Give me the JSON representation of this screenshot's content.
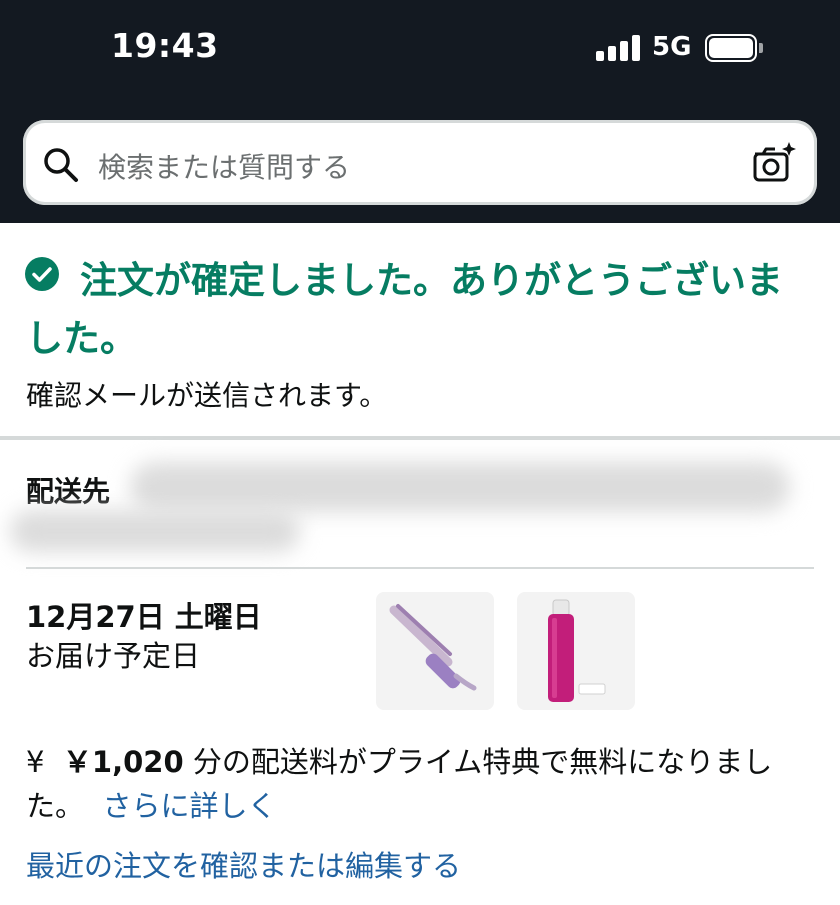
{
  "status_bar": {
    "time": "19:43",
    "network": "5G"
  },
  "search": {
    "placeholder": "検索または質問する"
  },
  "confirmation": {
    "title": "注文が確定しました。ありがとうございました。",
    "subtitle": "確認メールが送信されます。",
    "accent_color": "#067d62"
  },
  "shipping_address": {
    "label": "配送先"
  },
  "delivery": {
    "date": "12月27日 土曜日",
    "note": "お届け予定日",
    "items": [
      {
        "icon": "curling-iron-product-image"
      },
      {
        "icon": "hair-spray-product-image"
      }
    ]
  },
  "shipping_fee": {
    "currency_symbol": "¥",
    "amount": "￥1,020",
    "text": "分の配送料がプライム特典で無料になりました。",
    "learn_more": "さらに詳しく"
  },
  "recent_orders_link": "最近の注文を確認または編集する",
  "colors": {
    "header_bg": "#131921",
    "link": "#2162a1"
  }
}
